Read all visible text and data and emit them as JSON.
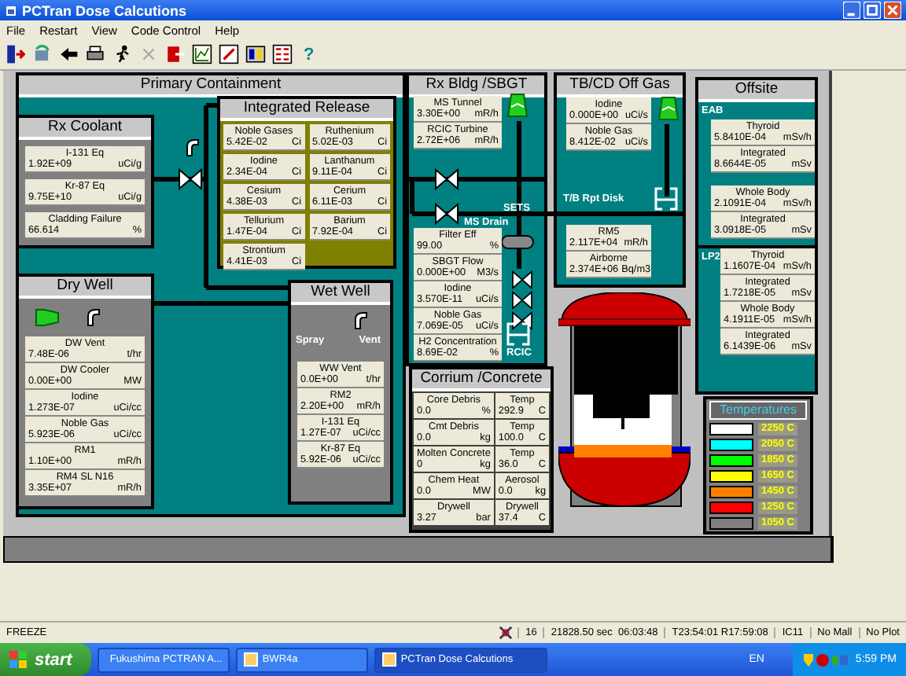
{
  "window": {
    "title": "PCTran Dose Calcutions"
  },
  "menu": [
    "File",
    "Restart",
    "View",
    "Code Control",
    "Help"
  ],
  "toolbar": {
    "help": "?"
  },
  "primary_containment": {
    "title": "Primary Containment"
  },
  "rx_coolant": {
    "title": "Rx Coolant",
    "cells": [
      {
        "label": "I-131 Eq",
        "value": "1.92E+09",
        "unit": "uCi/g"
      },
      {
        "label": "Kr-87 Eq",
        "value": "9.75E+10",
        "unit": "uCi/g"
      },
      {
        "label": "Cladding Failure",
        "value": "66.614",
        "unit": "%"
      }
    ]
  },
  "integrated_release": {
    "title": "Integrated Release",
    "cells": [
      {
        "label": "Noble Gases",
        "value": "5.42E-02",
        "unit": "Ci"
      },
      {
        "label": "Ruthenium",
        "value": "5.02E-03",
        "unit": "Ci"
      },
      {
        "label": "Iodine",
        "value": "2.34E-04",
        "unit": "Ci"
      },
      {
        "label": "Lanthanum",
        "value": "9.11E-04",
        "unit": "Ci"
      },
      {
        "label": "Cesium",
        "value": "4.38E-03",
        "unit": "Ci"
      },
      {
        "label": "Cerium",
        "value": "6.11E-03",
        "unit": "Ci"
      },
      {
        "label": "Tellurium",
        "value": "1.47E-04",
        "unit": "Ci"
      },
      {
        "label": "Barium",
        "value": "7.92E-04",
        "unit": "Ci"
      },
      {
        "label": "Strontium",
        "value": "4.41E-03",
        "unit": "Ci"
      }
    ]
  },
  "dry_well": {
    "title": "Dry Well",
    "cells": [
      {
        "label": "DW Vent",
        "value": "7.48E-06",
        "unit": "t/hr"
      },
      {
        "label": "DW Cooler",
        "value": "0.00E+00",
        "unit": "MW"
      },
      {
        "label": "Iodine",
        "value": "1.273E-07",
        "unit": "uCi/cc"
      },
      {
        "label": "Noble Gas",
        "value": "5.923E-06",
        "unit": "uCi/cc"
      },
      {
        "label": "RM1",
        "value": "1.10E+00",
        "unit": "mR/h"
      },
      {
        "label": "RM4 SL N16",
        "value": "3.35E+07",
        "unit": "mR/h"
      }
    ]
  },
  "wet_well": {
    "title": "Wet Well",
    "spray_label": "Spray",
    "vent_label": "Vent",
    "cells": [
      {
        "label": "WW Vent",
        "value": "0.0E+00",
        "unit": "t/hr"
      },
      {
        "label": "RM2",
        "value": "2.20E+00",
        "unit": "mR/h"
      },
      {
        "label": "I-131 Eq",
        "value": "1.27E-07",
        "unit": "uCi/cc"
      },
      {
        "label": "Kr-87 Eq",
        "value": "5.92E-06",
        "unit": "uCi/cc"
      }
    ]
  },
  "rx_bldg": {
    "title": "Rx Bldg /SBGT",
    "upper_cells": [
      {
        "label": "MS Tunnel",
        "value": "3.30E+00",
        "unit": "mR/h"
      },
      {
        "label": "RCIC Turbine",
        "value": "2.72E+06",
        "unit": "mR/h"
      }
    ],
    "sets_label": "SETS",
    "ms_drain_label": "MS Drain",
    "rcic_label": "RCIC",
    "lower_cells": [
      {
        "label": "Filter Eff",
        "value": "99.00",
        "unit": "%"
      },
      {
        "label": "SBGT Flow",
        "value": "0.000E+00",
        "unit": "M3/s"
      },
      {
        "label": "Iodine",
        "value": "3.570E-11",
        "unit": "uCi/s"
      },
      {
        "label": "Noble Gas",
        "value": "7.069E-05",
        "unit": "uCi/s"
      },
      {
        "label": "H2 Concentration",
        "value": "8.69E-02",
        "unit": "%"
      }
    ]
  },
  "off_gas": {
    "title": "TB/CD Off Gas",
    "upper_cells": [
      {
        "label": "Iodine",
        "value": "0.000E+00",
        "unit": "uCi/s"
      },
      {
        "label": "Noble Gas",
        "value": "8.412E-02",
        "unit": "uCi/s"
      }
    ],
    "disk_label": "T/B Rpt Disk",
    "lower_cells": [
      {
        "label": "RM5",
        "value": "2.117E+04",
        "unit": "mR/h"
      },
      {
        "label": "Airborne",
        "value": "2.374E+06",
        "unit": "Bq/m3"
      }
    ]
  },
  "corium": {
    "title": "Corrium /Concrete",
    "cells": [
      {
        "label": "Core Debris",
        "value": "0.0",
        "unit": "%"
      },
      {
        "label": "Temp",
        "value": "292.9",
        "unit": "C"
      },
      {
        "label": "Cmt Debris",
        "value": "0.0",
        "unit": "kg"
      },
      {
        "label": "Temp",
        "value": "100.0",
        "unit": "C"
      },
      {
        "label": "Molten Concrete",
        "value": "0",
        "unit": "kg"
      },
      {
        "label": "Temp",
        "value": "36.0",
        "unit": "C"
      },
      {
        "label": "Chem Heat",
        "value": "0.0",
        "unit": "MW"
      },
      {
        "label": "Aerosol",
        "value": "0.0",
        "unit": "kg"
      },
      {
        "label": "Drywell",
        "value": "3.27",
        "unit": "bar"
      },
      {
        "label": "Drywell",
        "value": "37.4",
        "unit": "C"
      }
    ]
  },
  "offsite": {
    "title": "Offsite",
    "sections": [
      {
        "label": "EAB",
        "groups": [
          [
            {
              "label": "Thyroid",
              "value": "5.8410E-04",
              "unit": "mSv/h"
            },
            {
              "label": "Integrated",
              "value": "8.6644E-05",
              "unit": "mSv"
            }
          ],
          [
            {
              "label": "Whole Body",
              "value": "2.1091E-04",
              "unit": "mSv/h"
            },
            {
              "label": "Integrated",
              "value": "3.0918E-05",
              "unit": "mSv"
            }
          ]
        ]
      },
      {
        "label": "LP2",
        "groups": [
          [
            {
              "label": "Thyroid",
              "value": "1.1607E-04",
              "unit": "mSv/h"
            },
            {
              "label": "Integrated",
              "value": "1.7218E-05",
              "unit": "mSv"
            },
            {
              "label": "Whole Body",
              "value": "4.1911E-05",
              "unit": "mSv/h"
            },
            {
              "label": "Integrated",
              "value": "6.1439E-06",
              "unit": "mSv"
            }
          ]
        ]
      }
    ]
  },
  "temperatures": {
    "title": "Temperatures",
    "items": [
      {
        "label": "2250 C",
        "color": "#ffffff"
      },
      {
        "label": "2050 C",
        "color": "#00ffff"
      },
      {
        "label": "1850 C",
        "color": "#00ff00"
      },
      {
        "label": "1650 C",
        "color": "#ffff00"
      },
      {
        "label": "1450 C",
        "color": "#ff8000"
      },
      {
        "label": "1250 C",
        "color": "#ff0000"
      },
      {
        "label": "1050 C",
        "color": "#808080"
      }
    ]
  },
  "status_bar": {
    "mode": "FREEZE",
    "fields": [
      "16",
      "21828.50 sec  06:03:48",
      "T23:54:01 R17:59:08",
      "IC11",
      "No Mall",
      "No Plot"
    ]
  },
  "taskbar": {
    "start": "start",
    "tasks": [
      {
        "label": "Fukushima PCTRAN A...",
        "selected": false
      },
      {
        "label": "BWR4a",
        "selected": false
      },
      {
        "label": "PCTran Dose Calcutions",
        "selected": true
      }
    ],
    "language": "EN",
    "clock": "5:59 PM"
  }
}
